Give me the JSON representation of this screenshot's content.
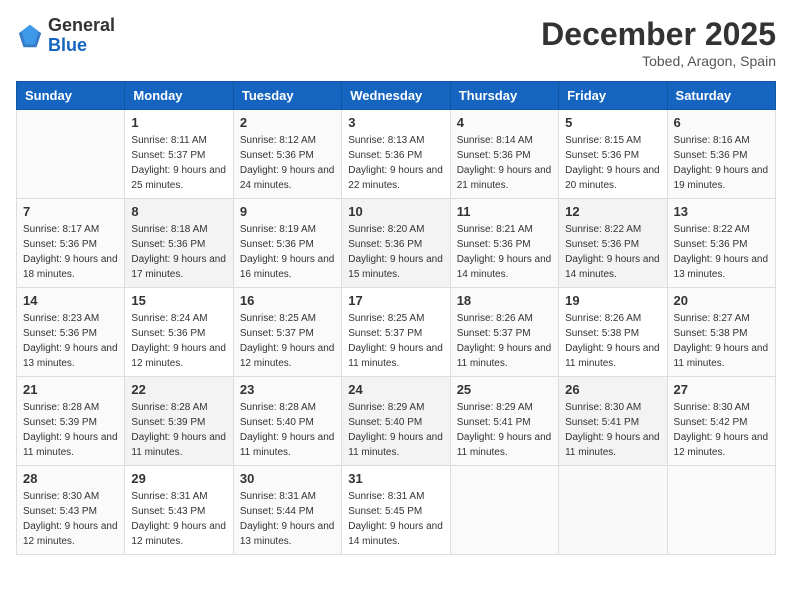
{
  "header": {
    "logo_general": "General",
    "logo_blue": "Blue",
    "month_title": "December 2025",
    "location": "Tobed, Aragon, Spain"
  },
  "days_of_week": [
    "Sunday",
    "Monday",
    "Tuesday",
    "Wednesday",
    "Thursday",
    "Friday",
    "Saturday"
  ],
  "weeks": [
    [
      {
        "day": "",
        "sunrise": "",
        "sunset": "",
        "daylight": ""
      },
      {
        "day": "1",
        "sunrise": "Sunrise: 8:11 AM",
        "sunset": "Sunset: 5:37 PM",
        "daylight": "Daylight: 9 hours and 25 minutes."
      },
      {
        "day": "2",
        "sunrise": "Sunrise: 8:12 AM",
        "sunset": "Sunset: 5:36 PM",
        "daylight": "Daylight: 9 hours and 24 minutes."
      },
      {
        "day": "3",
        "sunrise": "Sunrise: 8:13 AM",
        "sunset": "Sunset: 5:36 PM",
        "daylight": "Daylight: 9 hours and 22 minutes."
      },
      {
        "day": "4",
        "sunrise": "Sunrise: 8:14 AM",
        "sunset": "Sunset: 5:36 PM",
        "daylight": "Daylight: 9 hours and 21 minutes."
      },
      {
        "day": "5",
        "sunrise": "Sunrise: 8:15 AM",
        "sunset": "Sunset: 5:36 PM",
        "daylight": "Daylight: 9 hours and 20 minutes."
      },
      {
        "day": "6",
        "sunrise": "Sunrise: 8:16 AM",
        "sunset": "Sunset: 5:36 PM",
        "daylight": "Daylight: 9 hours and 19 minutes."
      }
    ],
    [
      {
        "day": "7",
        "sunrise": "Sunrise: 8:17 AM",
        "sunset": "Sunset: 5:36 PM",
        "daylight": "Daylight: 9 hours and 18 minutes."
      },
      {
        "day": "8",
        "sunrise": "Sunrise: 8:18 AM",
        "sunset": "Sunset: 5:36 PM",
        "daylight": "Daylight: 9 hours and 17 minutes."
      },
      {
        "day": "9",
        "sunrise": "Sunrise: 8:19 AM",
        "sunset": "Sunset: 5:36 PM",
        "daylight": "Daylight: 9 hours and 16 minutes."
      },
      {
        "day": "10",
        "sunrise": "Sunrise: 8:20 AM",
        "sunset": "Sunset: 5:36 PM",
        "daylight": "Daylight: 9 hours and 15 minutes."
      },
      {
        "day": "11",
        "sunrise": "Sunrise: 8:21 AM",
        "sunset": "Sunset: 5:36 PM",
        "daylight": "Daylight: 9 hours and 14 minutes."
      },
      {
        "day": "12",
        "sunrise": "Sunrise: 8:22 AM",
        "sunset": "Sunset: 5:36 PM",
        "daylight": "Daylight: 9 hours and 14 minutes."
      },
      {
        "day": "13",
        "sunrise": "Sunrise: 8:22 AM",
        "sunset": "Sunset: 5:36 PM",
        "daylight": "Daylight: 9 hours and 13 minutes."
      }
    ],
    [
      {
        "day": "14",
        "sunrise": "Sunrise: 8:23 AM",
        "sunset": "Sunset: 5:36 PM",
        "daylight": "Daylight: 9 hours and 13 minutes."
      },
      {
        "day": "15",
        "sunrise": "Sunrise: 8:24 AM",
        "sunset": "Sunset: 5:36 PM",
        "daylight": "Daylight: 9 hours and 12 minutes."
      },
      {
        "day": "16",
        "sunrise": "Sunrise: 8:25 AM",
        "sunset": "Sunset: 5:37 PM",
        "daylight": "Daylight: 9 hours and 12 minutes."
      },
      {
        "day": "17",
        "sunrise": "Sunrise: 8:25 AM",
        "sunset": "Sunset: 5:37 PM",
        "daylight": "Daylight: 9 hours and 11 minutes."
      },
      {
        "day": "18",
        "sunrise": "Sunrise: 8:26 AM",
        "sunset": "Sunset: 5:37 PM",
        "daylight": "Daylight: 9 hours and 11 minutes."
      },
      {
        "day": "19",
        "sunrise": "Sunrise: 8:26 AM",
        "sunset": "Sunset: 5:38 PM",
        "daylight": "Daylight: 9 hours and 11 minutes."
      },
      {
        "day": "20",
        "sunrise": "Sunrise: 8:27 AM",
        "sunset": "Sunset: 5:38 PM",
        "daylight": "Daylight: 9 hours and 11 minutes."
      }
    ],
    [
      {
        "day": "21",
        "sunrise": "Sunrise: 8:28 AM",
        "sunset": "Sunset: 5:39 PM",
        "daylight": "Daylight: 9 hours and 11 minutes."
      },
      {
        "day": "22",
        "sunrise": "Sunrise: 8:28 AM",
        "sunset": "Sunset: 5:39 PM",
        "daylight": "Daylight: 9 hours and 11 minutes."
      },
      {
        "day": "23",
        "sunrise": "Sunrise: 8:28 AM",
        "sunset": "Sunset: 5:40 PM",
        "daylight": "Daylight: 9 hours and 11 minutes."
      },
      {
        "day": "24",
        "sunrise": "Sunrise: 8:29 AM",
        "sunset": "Sunset: 5:40 PM",
        "daylight": "Daylight: 9 hours and 11 minutes."
      },
      {
        "day": "25",
        "sunrise": "Sunrise: 8:29 AM",
        "sunset": "Sunset: 5:41 PM",
        "daylight": "Daylight: 9 hours and 11 minutes."
      },
      {
        "day": "26",
        "sunrise": "Sunrise: 8:30 AM",
        "sunset": "Sunset: 5:41 PM",
        "daylight": "Daylight: 9 hours and 11 minutes."
      },
      {
        "day": "27",
        "sunrise": "Sunrise: 8:30 AM",
        "sunset": "Sunset: 5:42 PM",
        "daylight": "Daylight: 9 hours and 12 minutes."
      }
    ],
    [
      {
        "day": "28",
        "sunrise": "Sunrise: 8:30 AM",
        "sunset": "Sunset: 5:43 PM",
        "daylight": "Daylight: 9 hours and 12 minutes."
      },
      {
        "day": "29",
        "sunrise": "Sunrise: 8:31 AM",
        "sunset": "Sunset: 5:43 PM",
        "daylight": "Daylight: 9 hours and 12 minutes."
      },
      {
        "day": "30",
        "sunrise": "Sunrise: 8:31 AM",
        "sunset": "Sunset: 5:44 PM",
        "daylight": "Daylight: 9 hours and 13 minutes."
      },
      {
        "day": "31",
        "sunrise": "Sunrise: 8:31 AM",
        "sunset": "Sunset: 5:45 PM",
        "daylight": "Daylight: 9 hours and 14 minutes."
      },
      {
        "day": "",
        "sunrise": "",
        "sunset": "",
        "daylight": ""
      },
      {
        "day": "",
        "sunrise": "",
        "sunset": "",
        "daylight": ""
      },
      {
        "day": "",
        "sunrise": "",
        "sunset": "",
        "daylight": ""
      }
    ]
  ]
}
